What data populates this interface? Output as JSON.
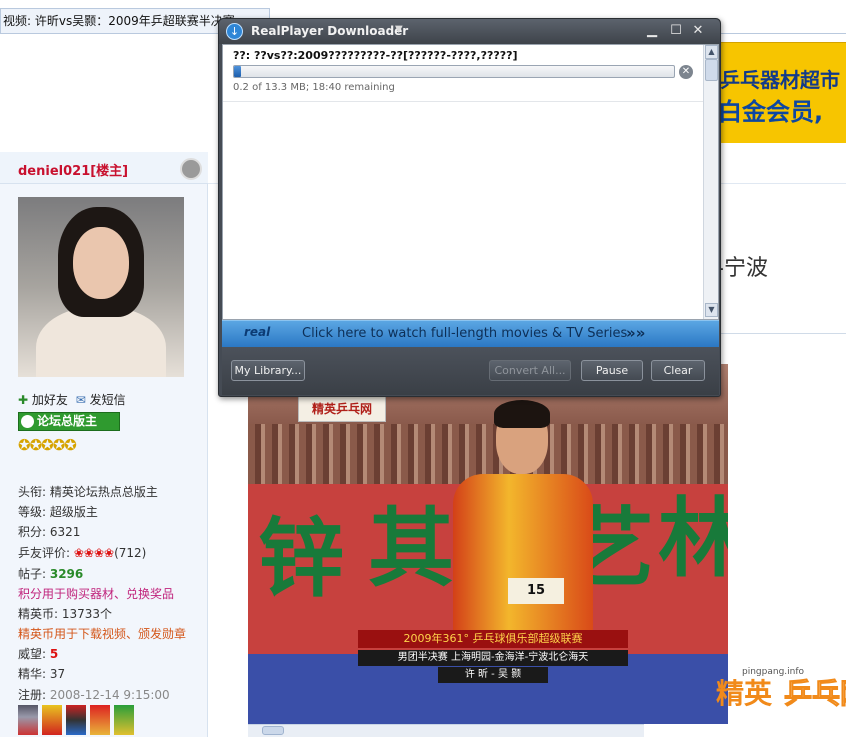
{
  "browser": {
    "tab_title": "视频: 许昕vs吴颢：2009年乒超联赛半决赛..."
  },
  "forum": {
    "username": "deniel021[楼主]",
    "add_friend": "加好友",
    "send_message": "发短信",
    "role_badge": "论坛总版主",
    "stars": "✪✪✪✪✪",
    "fields": [
      {
        "label": "头衔: ",
        "value": "精英论坛热点总版主"
      },
      {
        "label": "等级: ",
        "value": "超级版主"
      },
      {
        "label": "积分: ",
        "value": "6321"
      },
      {
        "label": "乒友评价: ",
        "value": "(712)"
      },
      {
        "label": "帖子: ",
        "value": "3296"
      },
      {
        "label": "",
        "value": "积分用于购买器材、兑换奖品"
      },
      {
        "label": "精英币: ",
        "value": "13733个"
      },
      {
        "label": "",
        "value": "精英币用于下载视频、颁发勋章"
      },
      {
        "label": "威望: ",
        "value": "5"
      },
      {
        "label": "精华: ",
        "value": "37"
      },
      {
        "label": "注册: ",
        "value": "2008-12-14 9:15:00"
      }
    ],
    "rating_flowers": "❀❀❀❀"
  },
  "right": {
    "ad_line1": "乒乓器材超市",
    "ad_line2": "白金会员,",
    "title_fragment": "-宁波"
  },
  "video": {
    "channel_logo": "精英乒乓网",
    "wall_chars": [
      "锌",
      "其",
      "艺",
      "林"
    ],
    "caption1": "2009年361° 乒乓球俱乐部超级联赛",
    "caption2": "男团半决赛 上海明园-金海洋-宁波北仑海天",
    "caption3": "许 昕 - 吴 颢",
    "number": "15",
    "watermark_url": "pingpang.info",
    "watermark_a": "精英",
    "watermark_b": "乒乓网"
  },
  "downloader": {
    "title": "RealPlayer Downloader",
    "filename": "??: ??vs??:2009?????????-??[??????-????,?????]",
    "progress": 0.015,
    "status": "0.2 of 13.3 MB; 18:40 remaining",
    "promo_brand": "real",
    "promo_text": "Click here to watch full-length movies & TV Series",
    "buttons": {
      "library": "My Library...",
      "convert": "Convert All...",
      "pause": "Pause",
      "clear": "Clear"
    }
  }
}
